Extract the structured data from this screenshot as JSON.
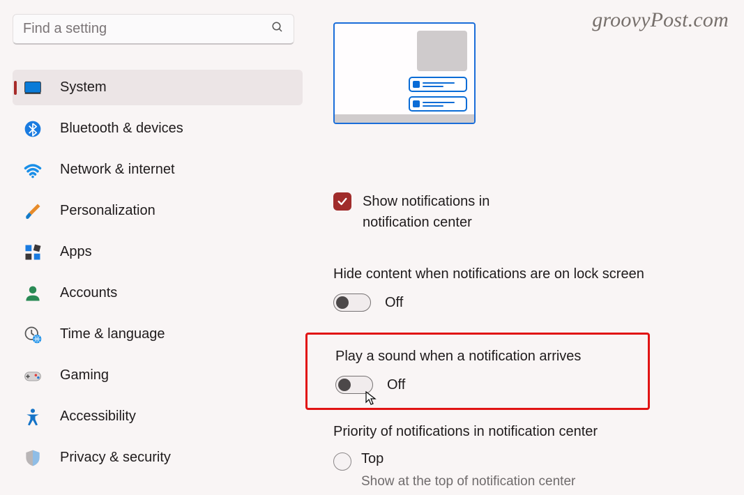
{
  "watermark": "groovyPost.com",
  "search": {
    "placeholder": "Find a setting"
  },
  "nav": {
    "items": [
      {
        "label": "System"
      },
      {
        "label": "Bluetooth & devices"
      },
      {
        "label": "Network & internet"
      },
      {
        "label": "Personalization"
      },
      {
        "label": "Apps"
      },
      {
        "label": "Accounts"
      },
      {
        "label": "Time & language"
      },
      {
        "label": "Gaming"
      },
      {
        "label": "Accessibility"
      },
      {
        "label": "Privacy & security"
      }
    ]
  },
  "settings": {
    "show_notifications": {
      "line1": "Show notifications in",
      "line2": "notification center",
      "checked": true
    },
    "hide_content": {
      "title": "Hide content when notifications are on lock screen",
      "state_label": "Off",
      "on": false
    },
    "play_sound": {
      "title": "Play a sound when a notification arrives",
      "state_label": "Off",
      "on": false
    },
    "priority": {
      "title": "Priority of notifications in notification center",
      "options": [
        {
          "label": "Top",
          "sub": "Show at the top of notification center"
        }
      ]
    }
  }
}
